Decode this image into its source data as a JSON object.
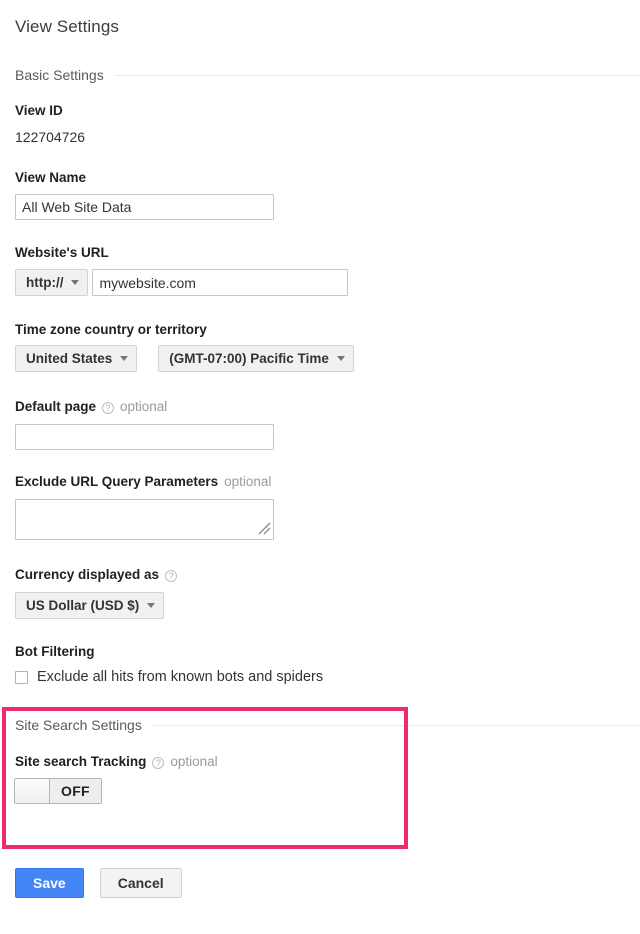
{
  "page": {
    "title": "View Settings"
  },
  "sections": {
    "basic": {
      "label": "Basic Settings"
    },
    "site_search": {
      "label": "Site Search Settings"
    }
  },
  "fields": {
    "view_id": {
      "label": "View ID",
      "value": "122704726"
    },
    "view_name": {
      "label": "View Name",
      "value": "All Web Site Data",
      "placeholder": ""
    },
    "website_url": {
      "label": "Website's URL",
      "protocol": "http://",
      "value": "mywebsite.com",
      "placeholder": ""
    },
    "time_zone": {
      "label": "Time zone country or territory",
      "country": "United States",
      "zone": "(GMT-07:00) Pacific Time"
    },
    "default_page": {
      "label": "Default page",
      "optional": "optional",
      "help": "?",
      "value": "",
      "placeholder": ""
    },
    "exclude_query_params": {
      "label": "Exclude URL Query Parameters",
      "optional": "optional",
      "value": "",
      "placeholder": ""
    },
    "currency": {
      "label": "Currency displayed as",
      "optional": "",
      "help": "?",
      "value": "US Dollar (USD $)"
    },
    "bot_filtering": {
      "label": "Bot Filtering",
      "checkbox_label": "Exclude all hits from known bots and spiders",
      "checked": false
    },
    "site_search_tracking": {
      "label": "Site search Tracking",
      "optional": "optional",
      "help": "?",
      "toggle_state": "OFF"
    }
  },
  "actions": {
    "save_label": "Save",
    "cancel_label": "Cancel"
  },
  "colors": {
    "highlight": "#ef2c6b",
    "primary_button": "#4385f5",
    "divider": "#ececec"
  }
}
